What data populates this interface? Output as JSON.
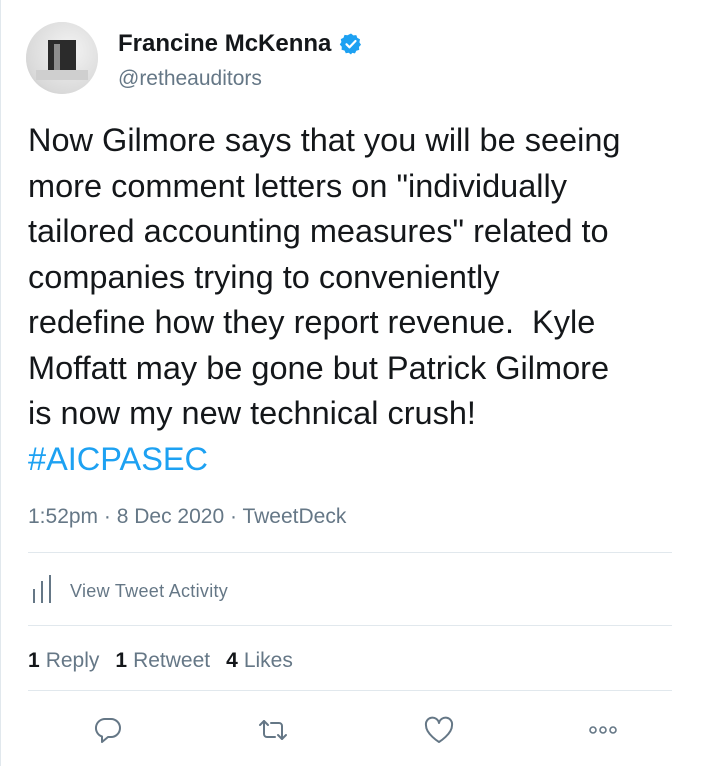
{
  "user": {
    "display_name": "Francine McKenna",
    "handle": "@retheauditors",
    "verified": true
  },
  "tweet": {
    "text_lines": [
      "Now Gilmore says that you will be seeing",
      "more comment letters on \"individually",
      "tailored accounting measures\" related to",
      "companies trying to conveniently",
      "redefine how they report revenue.  Kyle",
      "Moffatt may be gone but Patrick Gilmore",
      "is now my new technical crush!"
    ],
    "hashtag": "#AICPASEC",
    "time": "1:52pm",
    "date": "8 Dec 2020",
    "source": "TweetDeck",
    "sep": "·"
  },
  "activity": {
    "label": "View Tweet Activity"
  },
  "stats": {
    "replies_count": "1",
    "replies_label": "Reply",
    "retweets_count": "1",
    "retweets_label": "Retweet",
    "likes_count": "4",
    "likes_label": "Likes"
  },
  "colors": {
    "link": "#1da1f2",
    "muted": "#657786",
    "text": "#14171a",
    "divider": "#e1e8ed"
  },
  "icons": [
    "verified-badge-icon",
    "analytics-bars-icon",
    "reply-icon",
    "retweet-icon",
    "like-heart-icon",
    "more-icon"
  ]
}
